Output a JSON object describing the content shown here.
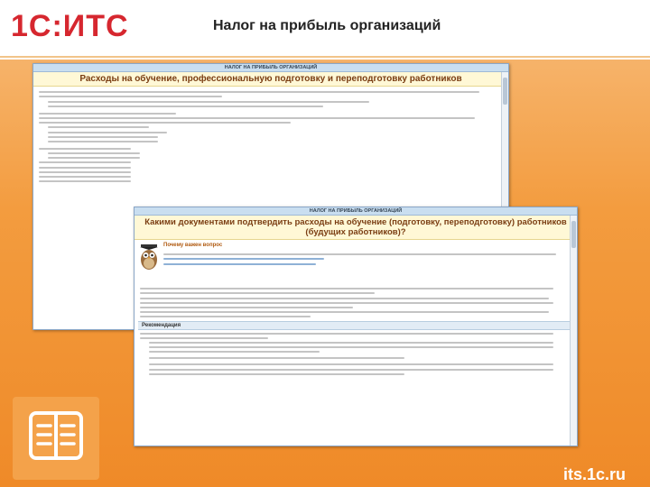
{
  "header": {
    "logo": "1С:ИТС",
    "title": "Налог на прибыль организаций"
  },
  "footer": {
    "url": "its.1c.ru"
  },
  "colors": {
    "accent": "#ef8a28",
    "logo_red": "#d6272f",
    "doc_heading": "#7a3d12"
  },
  "doc1": {
    "topbar": "НАЛОГ НА ПРИБЫЛЬ ОРГАНИЗАЦИЙ",
    "heading": "Расходы на обучение, профессиональную подготовку и переподготовку работников"
  },
  "doc2": {
    "topbar": "НАЛОГ НА ПРИБЫЛЬ ОРГАНИЗАЦИЙ",
    "heading": "Какими документами подтвердить расходы на обучение (подготовку, переподготовку) работников (будущих работников)?",
    "why_title": "Почему важен вопрос",
    "recommendation_title": "Рекомендация"
  }
}
